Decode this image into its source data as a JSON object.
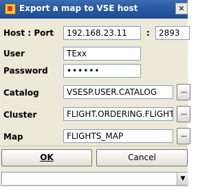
{
  "window": {
    "title": "Export a map to VSE host",
    "close_glyph": "✕"
  },
  "form": {
    "host_port_label": "Host : Port",
    "host_value": "192.168.23.11",
    "port_separator": ":",
    "port_value": "2893",
    "user_label": "User",
    "user_value": "TExx",
    "password_label": "Password",
    "password_value": "••••••",
    "catalog_label": "Catalog",
    "catalog_value": "VSESP.USER.CATALOG",
    "cluster_label": "Cluster",
    "cluster_value": "FLIGHT.ORDERING.FLIGHT",
    "map_label": "Map",
    "map_value": "FLIGHTS_MAP",
    "browse_label": "..."
  },
  "buttons": {
    "ok_label": "OK",
    "cancel_label": "Cancel"
  },
  "icons": {
    "title": "java-app-icon",
    "close": "close-icon",
    "dropdown": "chevron-down-icon"
  }
}
